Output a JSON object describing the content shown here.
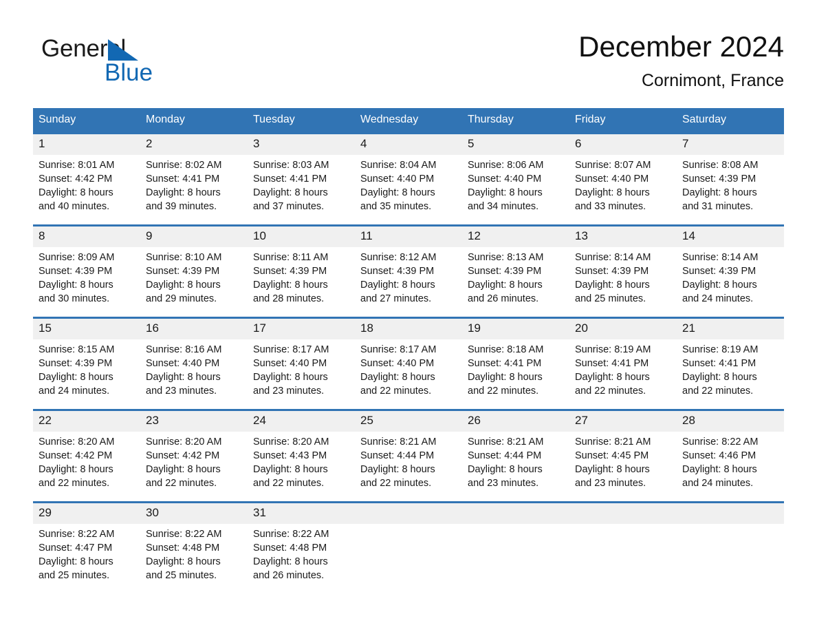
{
  "brand": {
    "name_part1": "General",
    "name_part2": "Blue",
    "triangle_icon": "triangle-icon",
    "color_blue": "#1268b3"
  },
  "header": {
    "title": "December 2024",
    "subtitle": "Cornimont, France"
  },
  "theme": {
    "header_bg": "#3174b4",
    "daynum_bg": "#f0f0f0",
    "text": "#1a1a1a"
  },
  "calendar": {
    "weekdays": [
      "Sunday",
      "Monday",
      "Tuesday",
      "Wednesday",
      "Thursday",
      "Friday",
      "Saturday"
    ],
    "weeks": [
      [
        {
          "day": "1",
          "sunrise": "Sunrise: 8:01 AM",
          "sunset": "Sunset: 4:42 PM",
          "daylight1": "Daylight: 8 hours",
          "daylight2": "and 40 minutes."
        },
        {
          "day": "2",
          "sunrise": "Sunrise: 8:02 AM",
          "sunset": "Sunset: 4:41 PM",
          "daylight1": "Daylight: 8 hours",
          "daylight2": "and 39 minutes."
        },
        {
          "day": "3",
          "sunrise": "Sunrise: 8:03 AM",
          "sunset": "Sunset: 4:41 PM",
          "daylight1": "Daylight: 8 hours",
          "daylight2": "and 37 minutes."
        },
        {
          "day": "4",
          "sunrise": "Sunrise: 8:04 AM",
          "sunset": "Sunset: 4:40 PM",
          "daylight1": "Daylight: 8 hours",
          "daylight2": "and 35 minutes."
        },
        {
          "day": "5",
          "sunrise": "Sunrise: 8:06 AM",
          "sunset": "Sunset: 4:40 PM",
          "daylight1": "Daylight: 8 hours",
          "daylight2": "and 34 minutes."
        },
        {
          "day": "6",
          "sunrise": "Sunrise: 8:07 AM",
          "sunset": "Sunset: 4:40 PM",
          "daylight1": "Daylight: 8 hours",
          "daylight2": "and 33 minutes."
        },
        {
          "day": "7",
          "sunrise": "Sunrise: 8:08 AM",
          "sunset": "Sunset: 4:39 PM",
          "daylight1": "Daylight: 8 hours",
          "daylight2": "and 31 minutes."
        }
      ],
      [
        {
          "day": "8",
          "sunrise": "Sunrise: 8:09 AM",
          "sunset": "Sunset: 4:39 PM",
          "daylight1": "Daylight: 8 hours",
          "daylight2": "and 30 minutes."
        },
        {
          "day": "9",
          "sunrise": "Sunrise: 8:10 AM",
          "sunset": "Sunset: 4:39 PM",
          "daylight1": "Daylight: 8 hours",
          "daylight2": "and 29 minutes."
        },
        {
          "day": "10",
          "sunrise": "Sunrise: 8:11 AM",
          "sunset": "Sunset: 4:39 PM",
          "daylight1": "Daylight: 8 hours",
          "daylight2": "and 28 minutes."
        },
        {
          "day": "11",
          "sunrise": "Sunrise: 8:12 AM",
          "sunset": "Sunset: 4:39 PM",
          "daylight1": "Daylight: 8 hours",
          "daylight2": "and 27 minutes."
        },
        {
          "day": "12",
          "sunrise": "Sunrise: 8:13 AM",
          "sunset": "Sunset: 4:39 PM",
          "daylight1": "Daylight: 8 hours",
          "daylight2": "and 26 minutes."
        },
        {
          "day": "13",
          "sunrise": "Sunrise: 8:14 AM",
          "sunset": "Sunset: 4:39 PM",
          "daylight1": "Daylight: 8 hours",
          "daylight2": "and 25 minutes."
        },
        {
          "day": "14",
          "sunrise": "Sunrise: 8:14 AM",
          "sunset": "Sunset: 4:39 PM",
          "daylight1": "Daylight: 8 hours",
          "daylight2": "and 24 minutes."
        }
      ],
      [
        {
          "day": "15",
          "sunrise": "Sunrise: 8:15 AM",
          "sunset": "Sunset: 4:39 PM",
          "daylight1": "Daylight: 8 hours",
          "daylight2": "and 24 minutes."
        },
        {
          "day": "16",
          "sunrise": "Sunrise: 8:16 AM",
          "sunset": "Sunset: 4:40 PM",
          "daylight1": "Daylight: 8 hours",
          "daylight2": "and 23 minutes."
        },
        {
          "day": "17",
          "sunrise": "Sunrise: 8:17 AM",
          "sunset": "Sunset: 4:40 PM",
          "daylight1": "Daylight: 8 hours",
          "daylight2": "and 23 minutes."
        },
        {
          "day": "18",
          "sunrise": "Sunrise: 8:17 AM",
          "sunset": "Sunset: 4:40 PM",
          "daylight1": "Daylight: 8 hours",
          "daylight2": "and 22 minutes."
        },
        {
          "day": "19",
          "sunrise": "Sunrise: 8:18 AM",
          "sunset": "Sunset: 4:41 PM",
          "daylight1": "Daylight: 8 hours",
          "daylight2": "and 22 minutes."
        },
        {
          "day": "20",
          "sunrise": "Sunrise: 8:19 AM",
          "sunset": "Sunset: 4:41 PM",
          "daylight1": "Daylight: 8 hours",
          "daylight2": "and 22 minutes."
        },
        {
          "day": "21",
          "sunrise": "Sunrise: 8:19 AM",
          "sunset": "Sunset: 4:41 PM",
          "daylight1": "Daylight: 8 hours",
          "daylight2": "and 22 minutes."
        }
      ],
      [
        {
          "day": "22",
          "sunrise": "Sunrise: 8:20 AM",
          "sunset": "Sunset: 4:42 PM",
          "daylight1": "Daylight: 8 hours",
          "daylight2": "and 22 minutes."
        },
        {
          "day": "23",
          "sunrise": "Sunrise: 8:20 AM",
          "sunset": "Sunset: 4:42 PM",
          "daylight1": "Daylight: 8 hours",
          "daylight2": "and 22 minutes."
        },
        {
          "day": "24",
          "sunrise": "Sunrise: 8:20 AM",
          "sunset": "Sunset: 4:43 PM",
          "daylight1": "Daylight: 8 hours",
          "daylight2": "and 22 minutes."
        },
        {
          "day": "25",
          "sunrise": "Sunrise: 8:21 AM",
          "sunset": "Sunset: 4:44 PM",
          "daylight1": "Daylight: 8 hours",
          "daylight2": "and 22 minutes."
        },
        {
          "day": "26",
          "sunrise": "Sunrise: 8:21 AM",
          "sunset": "Sunset: 4:44 PM",
          "daylight1": "Daylight: 8 hours",
          "daylight2": "and 23 minutes."
        },
        {
          "day": "27",
          "sunrise": "Sunrise: 8:21 AM",
          "sunset": "Sunset: 4:45 PM",
          "daylight1": "Daylight: 8 hours",
          "daylight2": "and 23 minutes."
        },
        {
          "day": "28",
          "sunrise": "Sunrise: 8:22 AM",
          "sunset": "Sunset: 4:46 PM",
          "daylight1": "Daylight: 8 hours",
          "daylight2": "and 24 minutes."
        }
      ],
      [
        {
          "day": "29",
          "sunrise": "Sunrise: 8:22 AM",
          "sunset": "Sunset: 4:47 PM",
          "daylight1": "Daylight: 8 hours",
          "daylight2": "and 25 minutes."
        },
        {
          "day": "30",
          "sunrise": "Sunrise: 8:22 AM",
          "sunset": "Sunset: 4:48 PM",
          "daylight1": "Daylight: 8 hours",
          "daylight2": "and 25 minutes."
        },
        {
          "day": "31",
          "sunrise": "Sunrise: 8:22 AM",
          "sunset": "Sunset: 4:48 PM",
          "daylight1": "Daylight: 8 hours",
          "daylight2": "and 26 minutes."
        },
        {
          "day": "",
          "sunrise": "",
          "sunset": "",
          "daylight1": "",
          "daylight2": ""
        },
        {
          "day": "",
          "sunrise": "",
          "sunset": "",
          "daylight1": "",
          "daylight2": ""
        },
        {
          "day": "",
          "sunrise": "",
          "sunset": "",
          "daylight1": "",
          "daylight2": ""
        },
        {
          "day": "",
          "sunrise": "",
          "sunset": "",
          "daylight1": "",
          "daylight2": ""
        }
      ]
    ]
  }
}
